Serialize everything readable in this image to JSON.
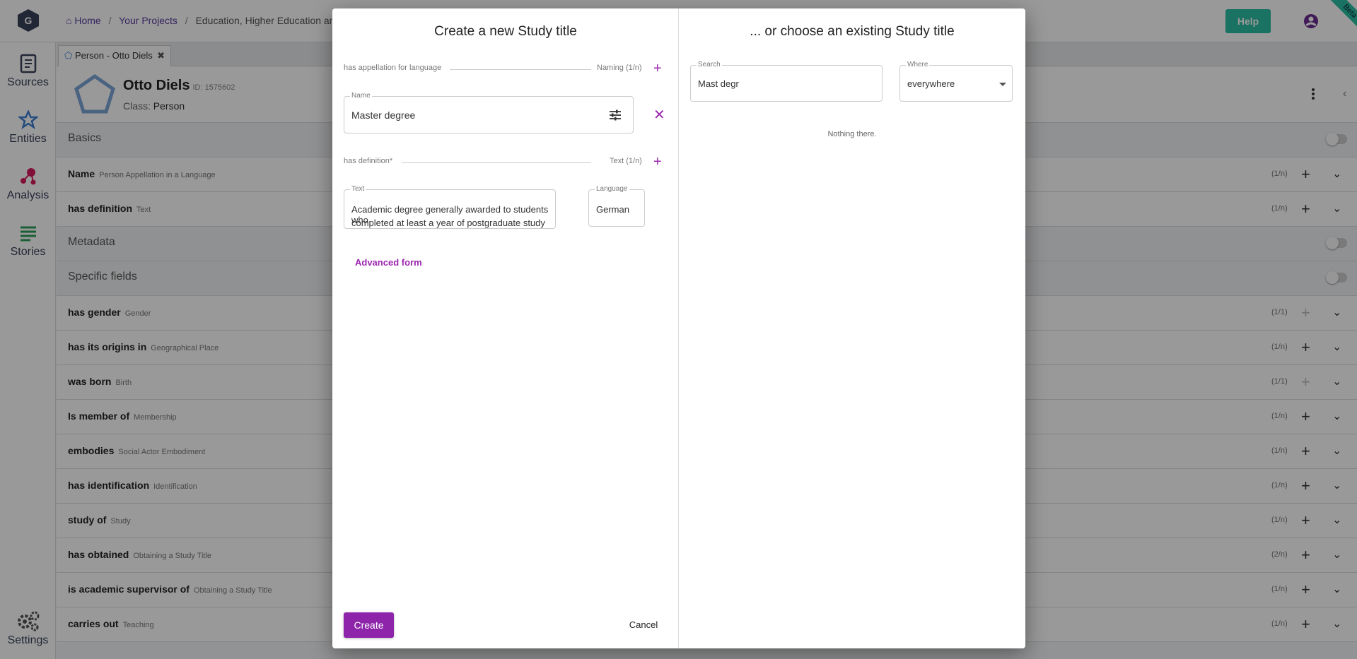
{
  "breadcrumb": {
    "home": "Home",
    "sep1": "/",
    "projects": "Your Projects",
    "sep2": "/",
    "current": "Education, Higher Education and Ac"
  },
  "topbar": {
    "help_label": "Help",
    "beta_label": "Beta"
  },
  "nav": [
    {
      "label": "Sources",
      "icon": "sources-icon"
    },
    {
      "label": "Entities",
      "icon": "entities-icon"
    },
    {
      "label": "Analysis",
      "icon": "analysis-icon"
    },
    {
      "label": "Stories",
      "icon": "stories-icon"
    },
    {
      "label": "Settings",
      "icon": "settings-icon"
    }
  ],
  "tab": {
    "label": "Person - Otto Diels"
  },
  "entity": {
    "name": "Otto Diels",
    "id": "ID: 1575602",
    "class_label": "Class:",
    "class_value": "Person"
  },
  "rows": [
    {
      "label": "Basics",
      "sub": "",
      "count": "",
      "type": "section"
    },
    {
      "label": "Name",
      "sub": "Person Appellation in a Language",
      "count": "(1/n)",
      "type": "field"
    },
    {
      "label": "has definition",
      "sub": "Text",
      "count": "(1/n)",
      "type": "field"
    },
    {
      "label": "Metadata",
      "sub": "",
      "count": "",
      "type": "section"
    },
    {
      "label": "Specific fields",
      "sub": "",
      "count": "",
      "type": "section"
    },
    {
      "label": "has gender",
      "sub": "Gender",
      "count": "(1/1)",
      "type": "field"
    },
    {
      "label": "has its origins in",
      "sub": "Geographical Place",
      "count": "(1/n)",
      "type": "field"
    },
    {
      "label": "was born",
      "sub": "Birth",
      "count": "(1/1)",
      "type": "field"
    },
    {
      "label": "Is member of",
      "sub": "Membership",
      "count": "(1/n)",
      "type": "field"
    },
    {
      "label": "embodies",
      "sub": "Social Actor Embodiment",
      "count": "(1/n)",
      "type": "field"
    },
    {
      "label": "has identification",
      "sub": "Identification",
      "count": "(1/n)",
      "type": "field"
    },
    {
      "label": "study of",
      "sub": "Study",
      "count": "(1/n)",
      "type": "field"
    },
    {
      "label": "has obtained",
      "sub": "Obtaining a Study Title",
      "count": "(2/n)",
      "type": "field"
    },
    {
      "label": "is academic supervisor of",
      "sub": "Obtaining a Study Title",
      "count": "(1/n)",
      "type": "field"
    },
    {
      "label": "carries out",
      "sub": "Teaching",
      "count": "(1/n)",
      "type": "field"
    }
  ],
  "dialog": {
    "left_title": "Create a new Study title",
    "appellation_label": "has appellation for language",
    "appellation_count": "Naming (1/n)",
    "name_field_label": "Name",
    "name_field_value": "Master degree",
    "definition_label": "has definition*",
    "definition_count": "Text (1/n)",
    "text_field_label": "Text",
    "text_field_line1": "Academic degree generally awarded to students who",
    "text_field_line2": "completed at least a year of postgraduate study",
    "language_field_label": "Language",
    "language_field_value": "German",
    "advanced_link": "Advanced form",
    "create_label": "Create",
    "cancel_label": "Cancel",
    "right_title": "... or choose an existing Study title",
    "search_label": "Search",
    "search_value": "Mast degr",
    "where_label": "Where",
    "where_value": "everywhere",
    "empty_message": "Nothing there."
  },
  "colors": {
    "accent_purple": "#9c27b0",
    "help_teal": "#2bbfa4",
    "brand_dark": "#39415a"
  }
}
